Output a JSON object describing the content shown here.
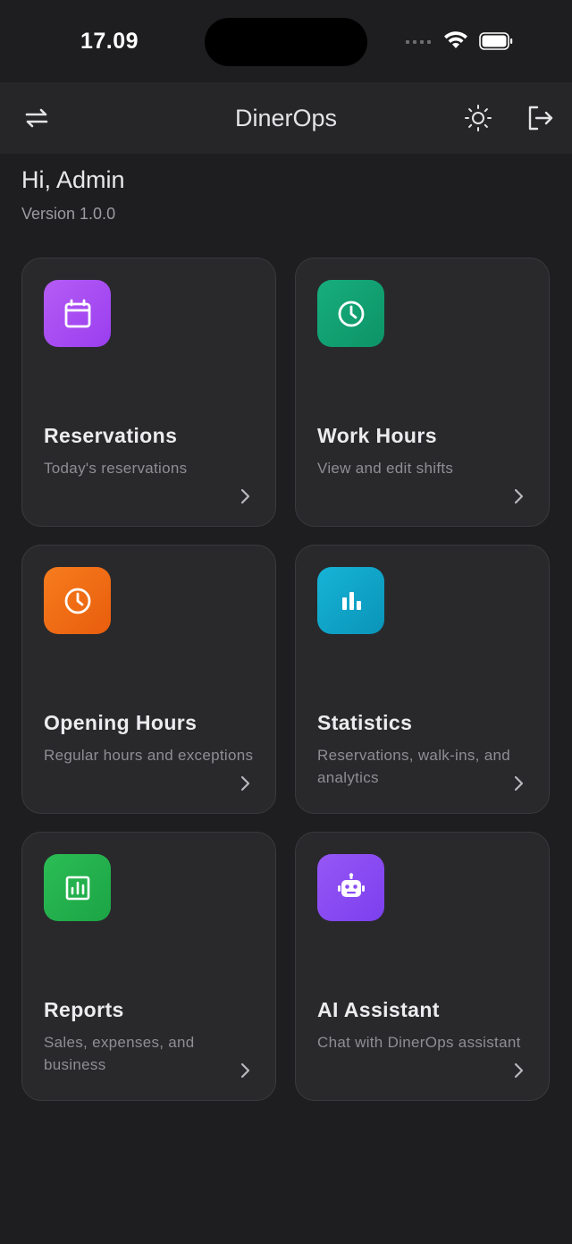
{
  "status_bar": {
    "time": "17.09"
  },
  "header": {
    "title": "DinerOps"
  },
  "greeting": {
    "title": "Hi, Admin",
    "version": "Version 1.0.0"
  },
  "cards": [
    {
      "title": "Reservations",
      "subtitle": "Today's reservations",
      "icon": "calendar-icon",
      "color": "#a445f2"
    },
    {
      "title": "Work Hours",
      "subtitle": "View and edit shifts",
      "icon": "clock-icon",
      "color": "#12a274"
    },
    {
      "title": "Opening Hours",
      "subtitle": "Regular hours and exceptions",
      "icon": "clock-icon",
      "color": "#f26a12"
    },
    {
      "title": "Statistics",
      "subtitle": "Reservations, walk-ins, and analytics",
      "icon": "bar-chart-icon",
      "color": "#0ea5c8"
    },
    {
      "title": "Reports",
      "subtitle": "Sales, expenses, and business",
      "icon": "report-icon",
      "color": "#22b14c"
    },
    {
      "title": "AI Assistant",
      "subtitle": "Chat with DinerOps assistant",
      "icon": "robot-icon",
      "color": "#8a4ff2"
    }
  ]
}
